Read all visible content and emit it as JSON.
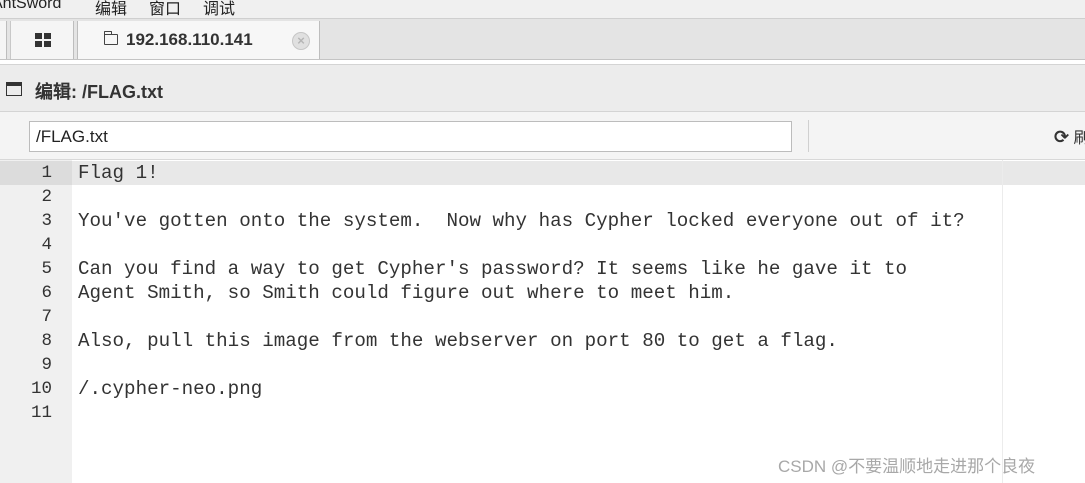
{
  "menubar": {
    "items": [
      "AntSword",
      "编辑",
      "窗口",
      "调试"
    ]
  },
  "tabs": {
    "host_label": "192.168.110.141",
    "close_glyph": "×",
    "icons": [
      "grid-icon",
      "folder-icon",
      "close-icon"
    ]
  },
  "panel": {
    "title": "编辑: /FLAG.txt",
    "icon": "window-icon"
  },
  "path_bar": {
    "value": "/FLAG.txt",
    "refresh_icon": "refresh-icon",
    "refresh_glyph": "⟳",
    "refresh_label": "刷"
  },
  "editor": {
    "lines": [
      {
        "n": "1",
        "text": "Flag 1!"
      },
      {
        "n": "2",
        "text": ""
      },
      {
        "n": "3",
        "text": "You've gotten onto the system.  Now why has Cypher locked everyone out of it?"
      },
      {
        "n": "4",
        "text": ""
      },
      {
        "n": "5",
        "text": "Can you find a way to get Cypher's password? It seems like he gave it to"
      },
      {
        "n": "6",
        "text": "Agent Smith, so Smith could figure out where to meet him."
      },
      {
        "n": "7",
        "text": ""
      },
      {
        "n": "8",
        "text": "Also, pull this image from the webserver on port 80 to get a flag."
      },
      {
        "n": "9",
        "text": ""
      },
      {
        "n": "10",
        "text": "/.cypher-neo.png"
      },
      {
        "n": "11",
        "text": ""
      }
    ]
  },
  "watermark": "CSDN @不要温顺地走进那个良夜"
}
